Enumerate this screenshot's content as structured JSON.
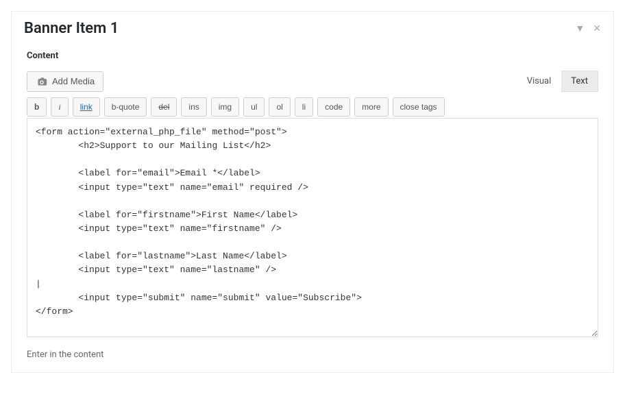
{
  "header": {
    "title": "Banner Item 1"
  },
  "field": {
    "label": "Content",
    "help": "Enter in the content"
  },
  "media": {
    "addLabel": "Add Media"
  },
  "tabs": {
    "visual": "Visual",
    "text": "Text",
    "active": "text"
  },
  "quicktags": {
    "b": "b",
    "i": "i",
    "link": "link",
    "bquote": "b-quote",
    "del": "del",
    "ins": "ins",
    "img": "img",
    "ul": "ul",
    "ol": "ol",
    "li": "li",
    "code": "code",
    "more": "more",
    "close": "close tags"
  },
  "editor": {
    "content": "<form action=\"external_php_file\" method=\"post\">\n        <h2>Support to our Mailing List</h2>\n\n        <label for=\"email\">Email *</label>\n        <input type=\"text\" name=\"email\" required />\n\n        <label for=\"firstname\">First Name</label>\n        <input type=\"text\" name=\"firstname\" />\n\n        <label for=\"lastname\">Last Name</label>\n        <input type=\"text\" name=\"lastname\" />\n|\n        <input type=\"submit\" name=\"submit\" value=\"Subscribe\">\n</form>"
  }
}
